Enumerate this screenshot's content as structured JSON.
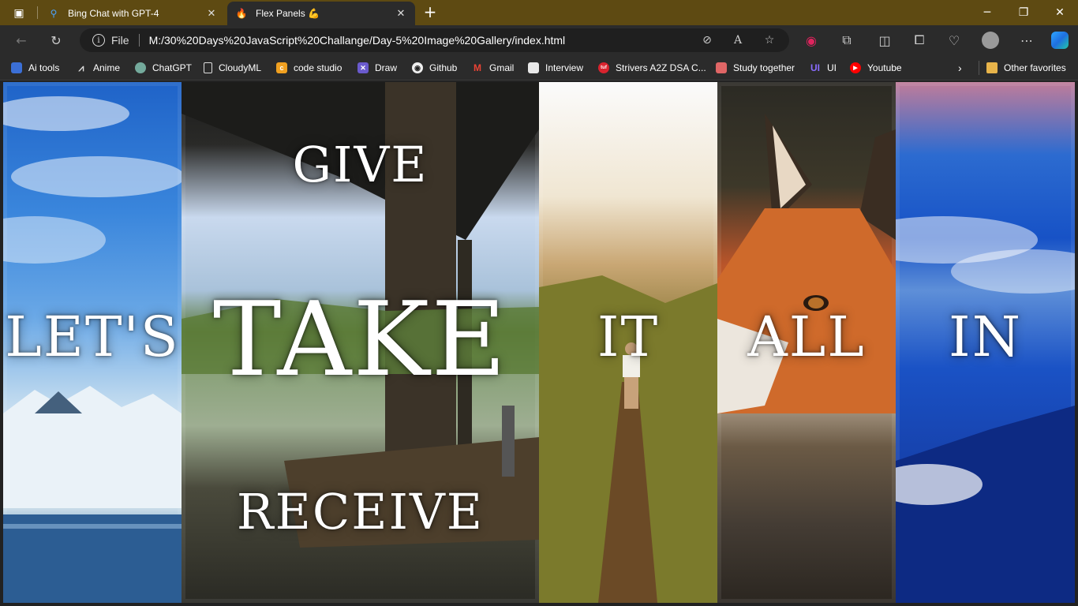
{
  "tabs": [
    {
      "title": "Bing Chat with GPT-4",
      "active": false
    },
    {
      "title": "Flex Panels 💪",
      "active": true
    }
  ],
  "toolbar": {
    "scheme": "File",
    "url": "M:/30%20Days%20JavaScript%20Challange/Day-5%20Image%20Gallery/index.html"
  },
  "bookmarks": [
    {
      "label": "Ai tools",
      "icon": "ai-tools-icon",
      "color": "#3b6fd6"
    },
    {
      "label": "Anime",
      "icon": "anime-icon",
      "color": "#444444"
    },
    {
      "label": "ChatGPT",
      "icon": "chatgpt-icon",
      "color": "#74aa9c"
    },
    {
      "label": "CloudyML",
      "icon": "page-icon",
      "color": "#555555"
    },
    {
      "label": "code studio",
      "icon": "code-studio-icon",
      "color": "#f0a020"
    },
    {
      "label": "Draw",
      "icon": "draw-icon",
      "color": "#6a5acd"
    },
    {
      "label": "Github",
      "icon": "github-icon",
      "color": "#333333"
    },
    {
      "label": "Gmail",
      "icon": "gmail-icon",
      "color": "#d93025"
    },
    {
      "label": "Interview",
      "icon": "interview-icon",
      "color": "#dddddd"
    },
    {
      "label": "Strivers A2Z DSA C...",
      "icon": "striver-icon",
      "color": "#d9232e"
    },
    {
      "label": "Study together",
      "icon": "study-together-icon",
      "color": "#e06666"
    },
    {
      "label": "UI",
      "icon": "ui-icon",
      "color": "#6a4df4"
    },
    {
      "label": "Youtube",
      "icon": "youtube-icon",
      "color": "#ff0000"
    }
  ],
  "other_favorites": "Other favorites",
  "panels": [
    {
      "word": "Let's"
    },
    {
      "top": "Give",
      "middle": "Take",
      "bottom": "Receive"
    },
    {
      "word": "It"
    },
    {
      "word": "All"
    },
    {
      "word": "In"
    }
  ]
}
